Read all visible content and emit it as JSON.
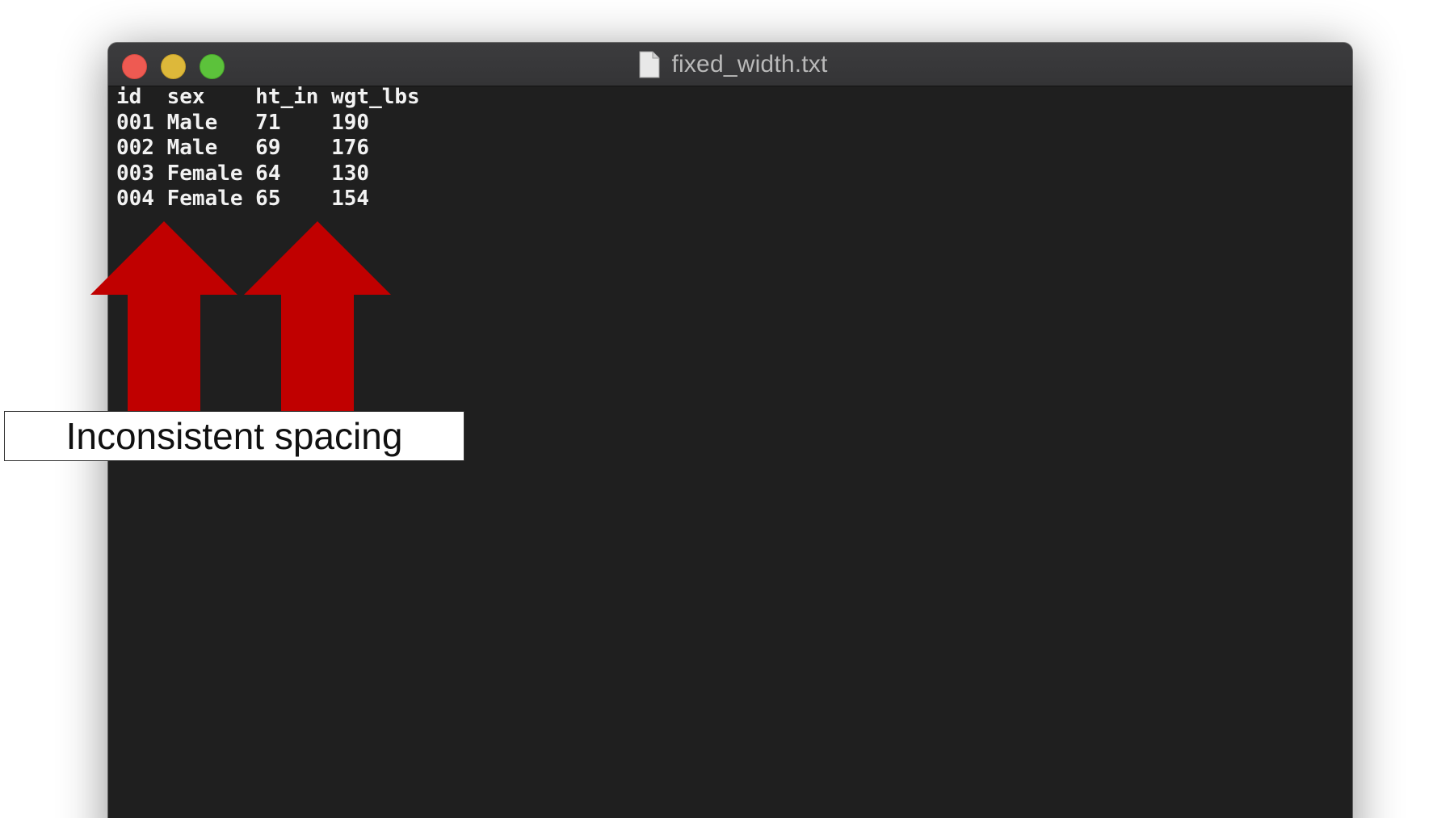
{
  "window": {
    "title": "fixed_width.txt",
    "file_icon": "document-icon",
    "buttons": [
      "close",
      "minimize",
      "maximize"
    ]
  },
  "file_lines": [
    "id  sex    ht_in wgt_lbs",
    "001 Male   71    190",
    "002 Male   69    176",
    "003 Female 64    130",
    "004 Female 65    154"
  ],
  "annotation": {
    "label": "Inconsistent spacing",
    "arrow_color": "#c00000",
    "arrow_icons": [
      "up-arrow-icon",
      "up-arrow-icon"
    ]
  },
  "colors": {
    "editor_background": "#1f1f1f",
    "text": "#f2f2f2",
    "close": "#ee5a52",
    "minimize": "#ddb83a",
    "maximize": "#5cc23b"
  }
}
